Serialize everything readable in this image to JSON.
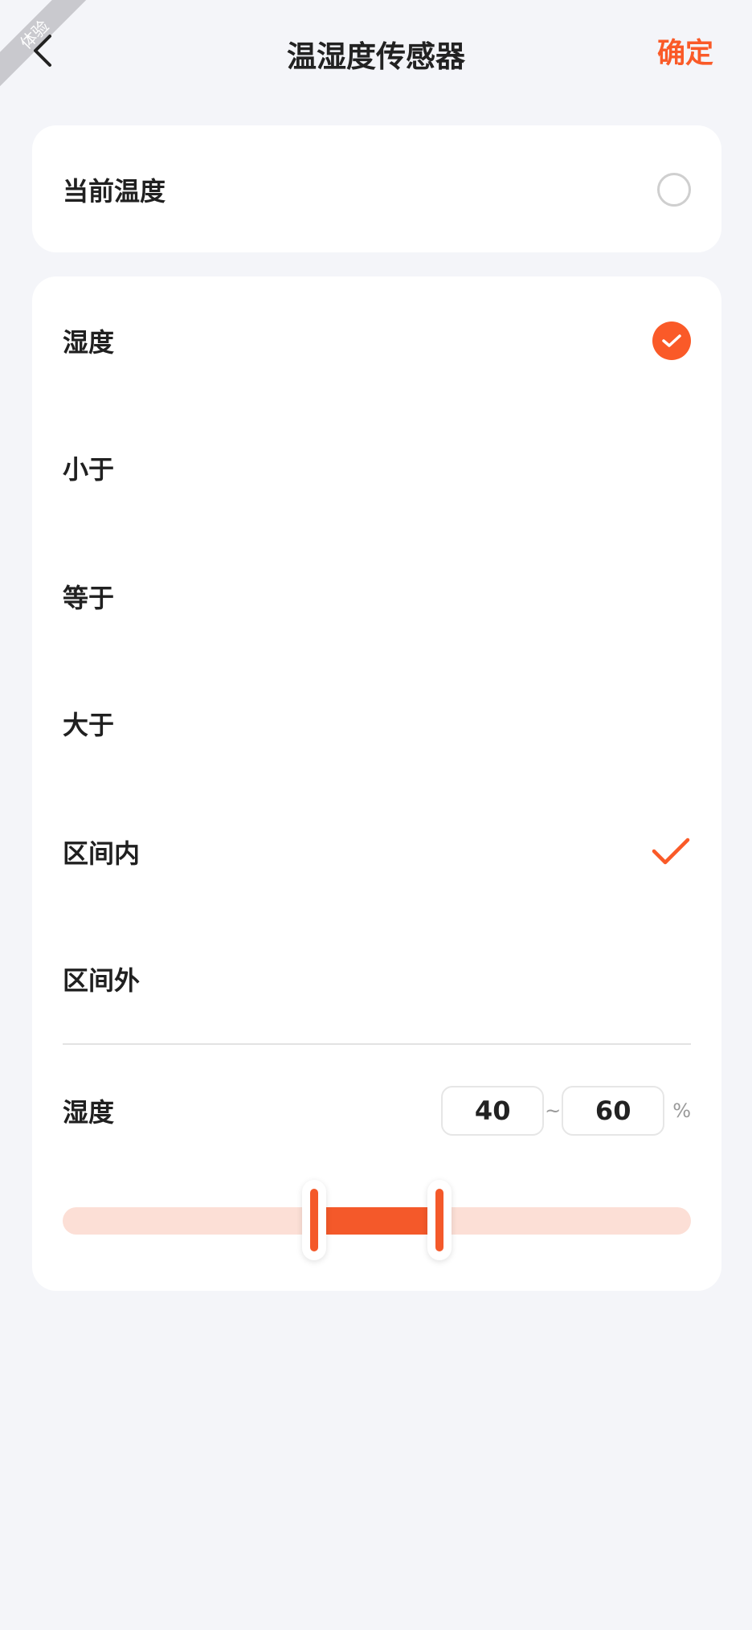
{
  "ribbon": {
    "text": "体验"
  },
  "header": {
    "title": "温湿度传感器",
    "confirm_label": "确定",
    "back_icon": "chevron-left-icon"
  },
  "current_temp": {
    "label": "当前温度",
    "selected": false
  },
  "humidity_section": {
    "label": "湿度",
    "selected": true,
    "options": [
      {
        "label": "小于",
        "selected": false
      },
      {
        "label": "等于",
        "selected": false
      },
      {
        "label": "大于",
        "selected": false
      },
      {
        "label": "区间内",
        "selected": true
      },
      {
        "label": "区间外",
        "selected": false
      }
    ]
  },
  "range": {
    "label": "湿度",
    "min_value": "40",
    "max_value": "60",
    "separator": "~",
    "unit": "%",
    "slider_low_fraction": 0.4,
    "slider_high_fraction": 0.6
  },
  "colors": {
    "accent": "#fa5a28",
    "track": "#fcdfd6",
    "background": "#f4f5f9"
  }
}
